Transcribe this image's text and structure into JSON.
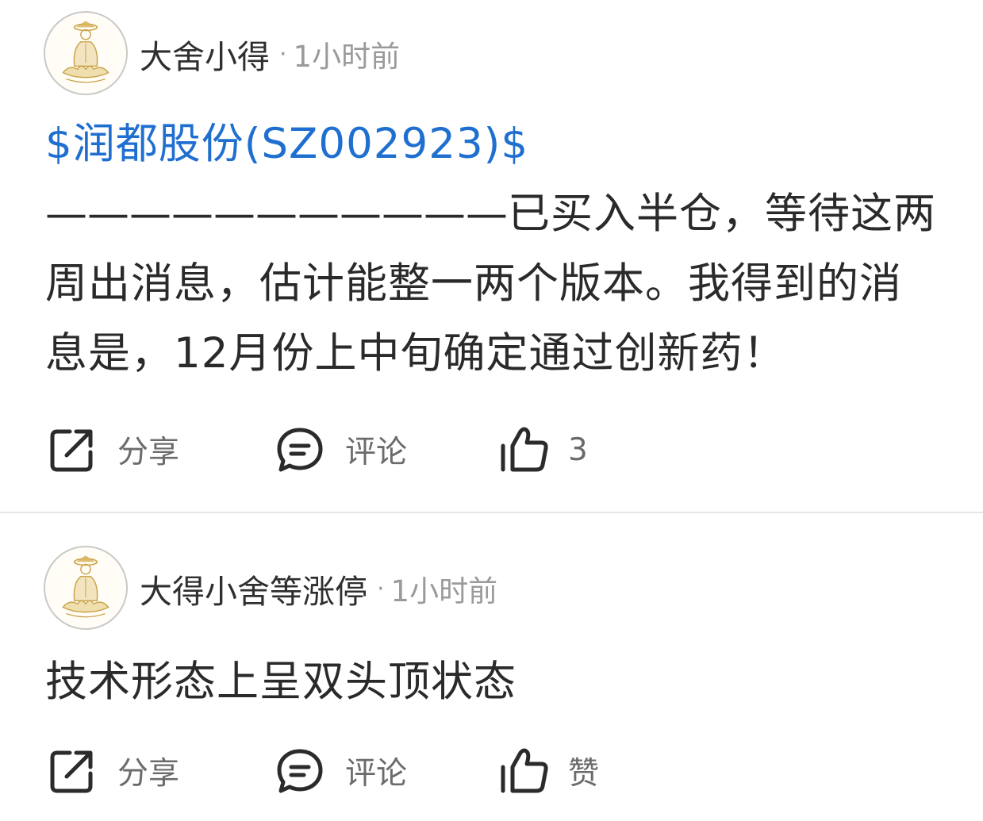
{
  "posts": [
    {
      "author": "大舍小得",
      "separator": "·",
      "time": "1小时前",
      "stock_link": "$润都股份(SZ002923)$",
      "dashes": "———————————",
      "body": "已买入半仓，等待这两周出消息，估计能整一两个版本。我得到的消息是，12月份上中旬确定通过创新药！",
      "actions": {
        "share_label": "分享",
        "comment_label": "评论",
        "like_label": "3"
      }
    },
    {
      "author": "大得小舍等涨停",
      "separator": "·",
      "time": "1小时前",
      "body": "技术形态上呈双头顶状态",
      "actions": {
        "share_label": "分享",
        "comment_label": "评论",
        "like_label": "赞"
      }
    }
  ],
  "icons": {
    "share": "share-icon",
    "comment": "comment-icon",
    "like": "thumbs-up-icon",
    "avatar": "meditating-figure-avatar"
  },
  "colors": {
    "link": "#1f6fd1",
    "text": "#2a2a2a",
    "meta": "#9a9a9a",
    "action_label": "#6b6b6b",
    "divider": "#e6e6e6"
  }
}
